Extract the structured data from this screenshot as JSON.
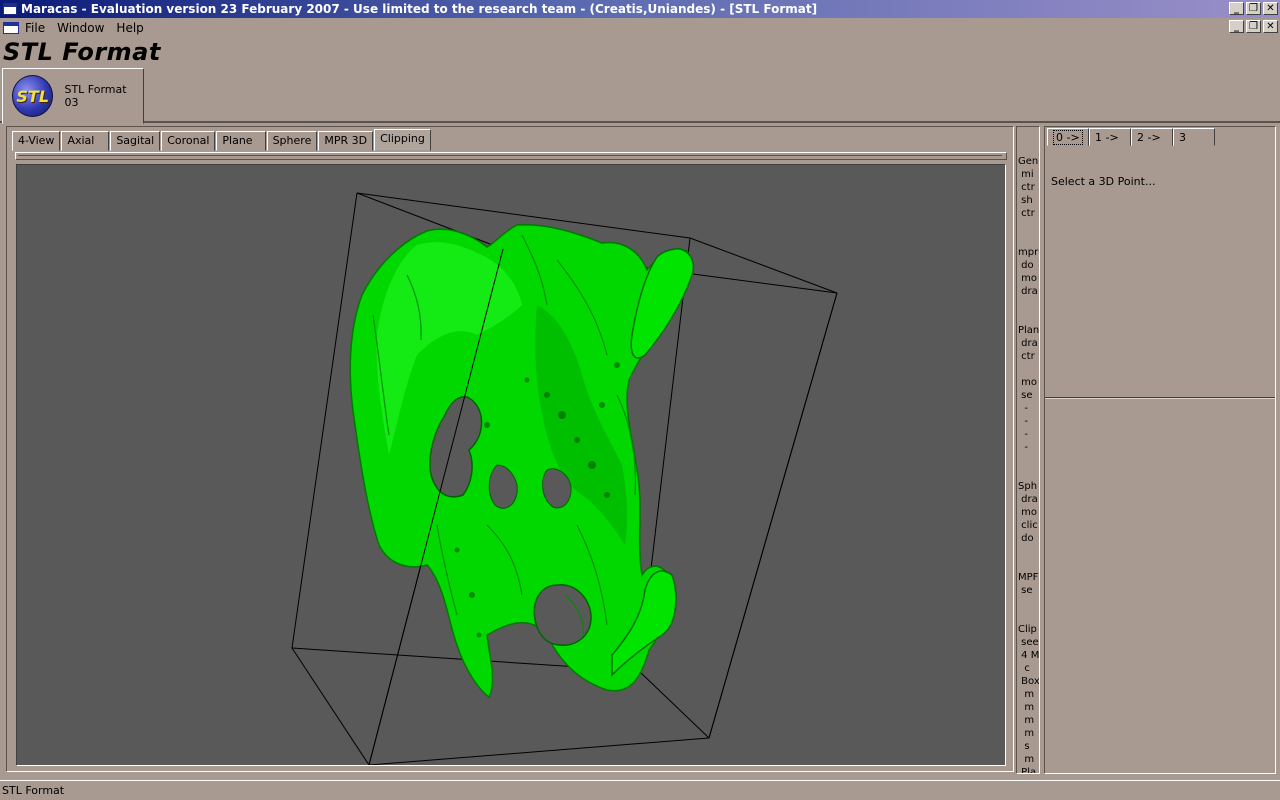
{
  "window": {
    "title": "Maracas - Evaluation version 23 February 2007 - Use limited to the research team - (Creatis,Uniandes) - [STL Format]",
    "controls": [
      "_",
      "❐",
      "✕"
    ]
  },
  "menu": {
    "items": [
      "File",
      "Window",
      "Help"
    ]
  },
  "heading": "STL Format",
  "module_tab": {
    "logo_text": "STL",
    "label": "STL Format 03"
  },
  "view_tabs": [
    "4-View",
    "Axial",
    "Sagital",
    "Coronal",
    "Plane",
    "Sphere",
    "MPR 3D",
    "Clipping"
  ],
  "active_view_tab": "Clipping",
  "help_text": "Gen\n mi\n ctr\n sh\n ctr\n\n\nmpr\n do\n mo\n dra\n\n\nPlan\n dra\n ctr\n\n mo\n se\n  -\n  -\n  -\n  -\n\n\nSph\n dra\n mo\n clic\n do\n\n\nMPF\n se\n\n\nClip\n see\n 4 M\n  c\n Box\n  m\n  m\n  m\n  m\n  s\n  m\n Pla",
  "right_tabs": [
    "0 ->",
    "1 ->",
    "2 ->",
    "3"
  ],
  "right_message": "Select a 3D Point...",
  "status": "STL Format",
  "colors": {
    "mesh": "#00e000",
    "viewport_bg": "#595959"
  }
}
